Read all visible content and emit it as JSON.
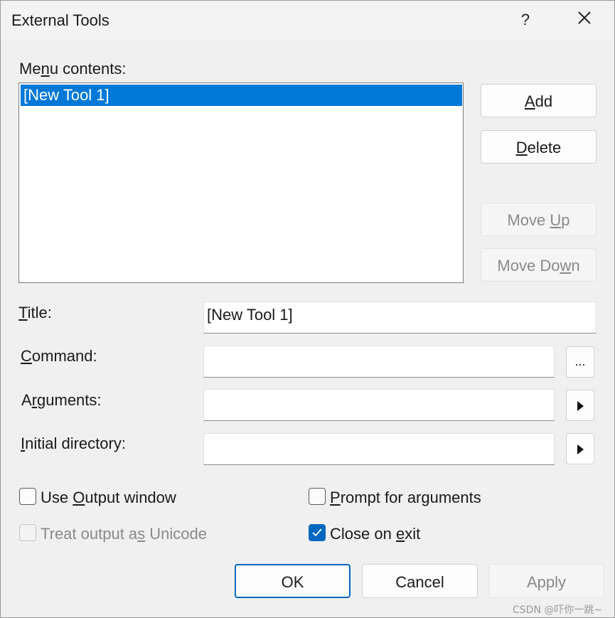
{
  "window": {
    "title": "External Tools",
    "help": "?"
  },
  "menu": {
    "label_pre": "Me",
    "label_u": "n",
    "label_post": "u contents:",
    "items": [
      "[New Tool 1]"
    ]
  },
  "buttons": {
    "add": {
      "pre": "",
      "u": "A",
      "post": "dd"
    },
    "delete": {
      "pre": "",
      "u": "D",
      "post": "elete"
    },
    "move_up": {
      "pre": "Move ",
      "u": "U",
      "post": "p"
    },
    "move_down": {
      "pre": "Move Do",
      "u": "w",
      "post": "n"
    },
    "browse": "...",
    "ok": "OK",
    "cancel": "Cancel",
    "apply": "Apply"
  },
  "fields": {
    "title": {
      "pre": "",
      "u": "T",
      "post": "itle:",
      "value": "[New Tool 1]"
    },
    "command": {
      "pre": "",
      "u": "C",
      "post": "ommand:",
      "value": ""
    },
    "arguments": {
      "pre": "A",
      "u": "r",
      "post": "guments:",
      "value": ""
    },
    "initial_directory": {
      "pre": "",
      "u": "I",
      "post": "nitial directory:",
      "value": ""
    }
  },
  "options": {
    "use_output": {
      "pre": "Use ",
      "u": "O",
      "post": "utput window",
      "checked": false
    },
    "prompt_args": {
      "pre": "",
      "u": "P",
      "post": "rompt for arguments",
      "checked": false
    },
    "treat_unicode": {
      "pre": "Treat output a",
      "u": "s",
      "post": " Unicode",
      "checked": false,
      "disabled": true
    },
    "close_on_exit": {
      "pre": "Close on ",
      "u": "e",
      "post": "xit",
      "checked": true
    }
  },
  "colors": {
    "accent": "#0067c0",
    "selection": "#0078d7"
  },
  "watermark": "CSDN @吓你一跳~"
}
